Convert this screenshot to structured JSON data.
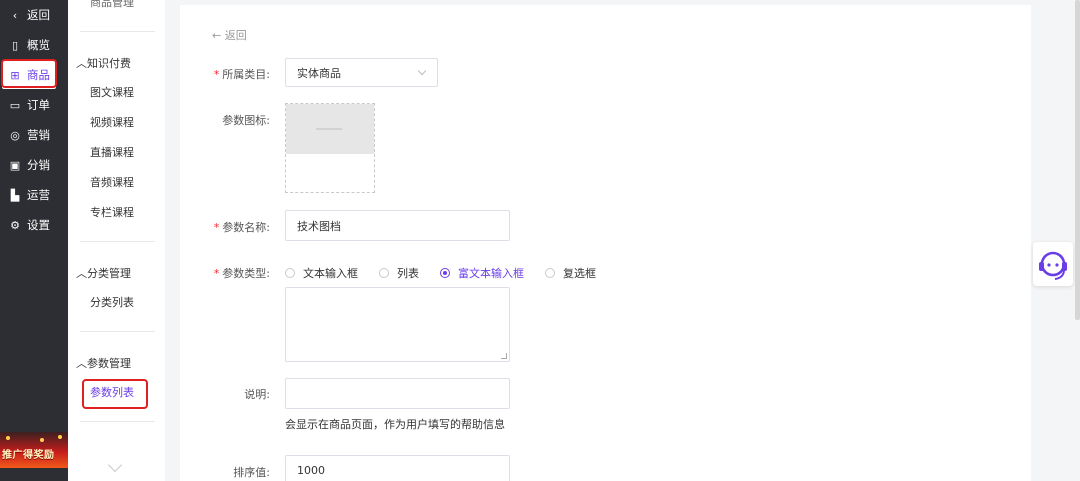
{
  "nav": {
    "back_label": "返回",
    "items": [
      {
        "icon": "overview-icon",
        "glyph": "▯",
        "label": "概览"
      },
      {
        "icon": "product-icon",
        "glyph": "⊞",
        "label": "商品"
      },
      {
        "icon": "order-icon",
        "glyph": "▭",
        "label": "订单"
      },
      {
        "icon": "marketing-icon",
        "glyph": "◎",
        "label": "营销"
      },
      {
        "icon": "distribution-icon",
        "glyph": "▣",
        "label": "分销"
      },
      {
        "icon": "operation-icon",
        "glyph": "▙",
        "label": "运营"
      },
      {
        "icon": "settings-icon",
        "glyph": "⚙",
        "label": "设置"
      }
    ],
    "promo_label": "推广得奖励"
  },
  "submenu": {
    "top_cut": "商品管理",
    "groups": [
      {
        "title": "知识付费",
        "items": [
          "图文课程",
          "视频课程",
          "直播课程",
          "音频课程",
          "专栏课程"
        ]
      },
      {
        "title": "分类管理",
        "items": [
          "分类列表"
        ]
      },
      {
        "title": "参数管理",
        "items": [
          "参数列表"
        ]
      }
    ]
  },
  "form": {
    "back_label": "返回",
    "category": {
      "label": "所属类目:",
      "value": "实体商品"
    },
    "icon": {
      "label": "参数图标:"
    },
    "name": {
      "label": "参数名称:",
      "value": "技术图档"
    },
    "type": {
      "label": "参数类型:",
      "options": [
        "文本输入框",
        "列表",
        "富文本输入框",
        "复选框"
      ],
      "selected": "富文本输入框"
    },
    "desc": {
      "label": "说明:",
      "value": "",
      "hint": "会显示在商品页面，作为用户填写的帮助信息"
    },
    "sort": {
      "label": "排序值:",
      "value": "1000"
    }
  },
  "colors": {
    "accent": "#6a3de8",
    "required": "#f5222d",
    "highlight": "#e02020"
  }
}
